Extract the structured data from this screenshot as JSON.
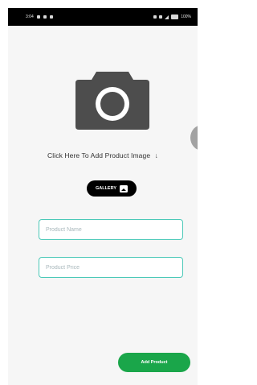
{
  "status_bar": {
    "time": "3:04",
    "battery": "100%"
  },
  "screen": {
    "add_image_prompt": "Click Here To Add Product Image",
    "arrow_glyph": "↓",
    "gallery_label": "GALLERY",
    "product_name_placeholder": "Product Name",
    "product_price_placeholder": "Product Price",
    "add_product_label": "Add Product"
  },
  "colors": {
    "field_border": "#4cc9b8",
    "add_button": "#1aa64a",
    "camera_icon": "#4d4d4d"
  }
}
